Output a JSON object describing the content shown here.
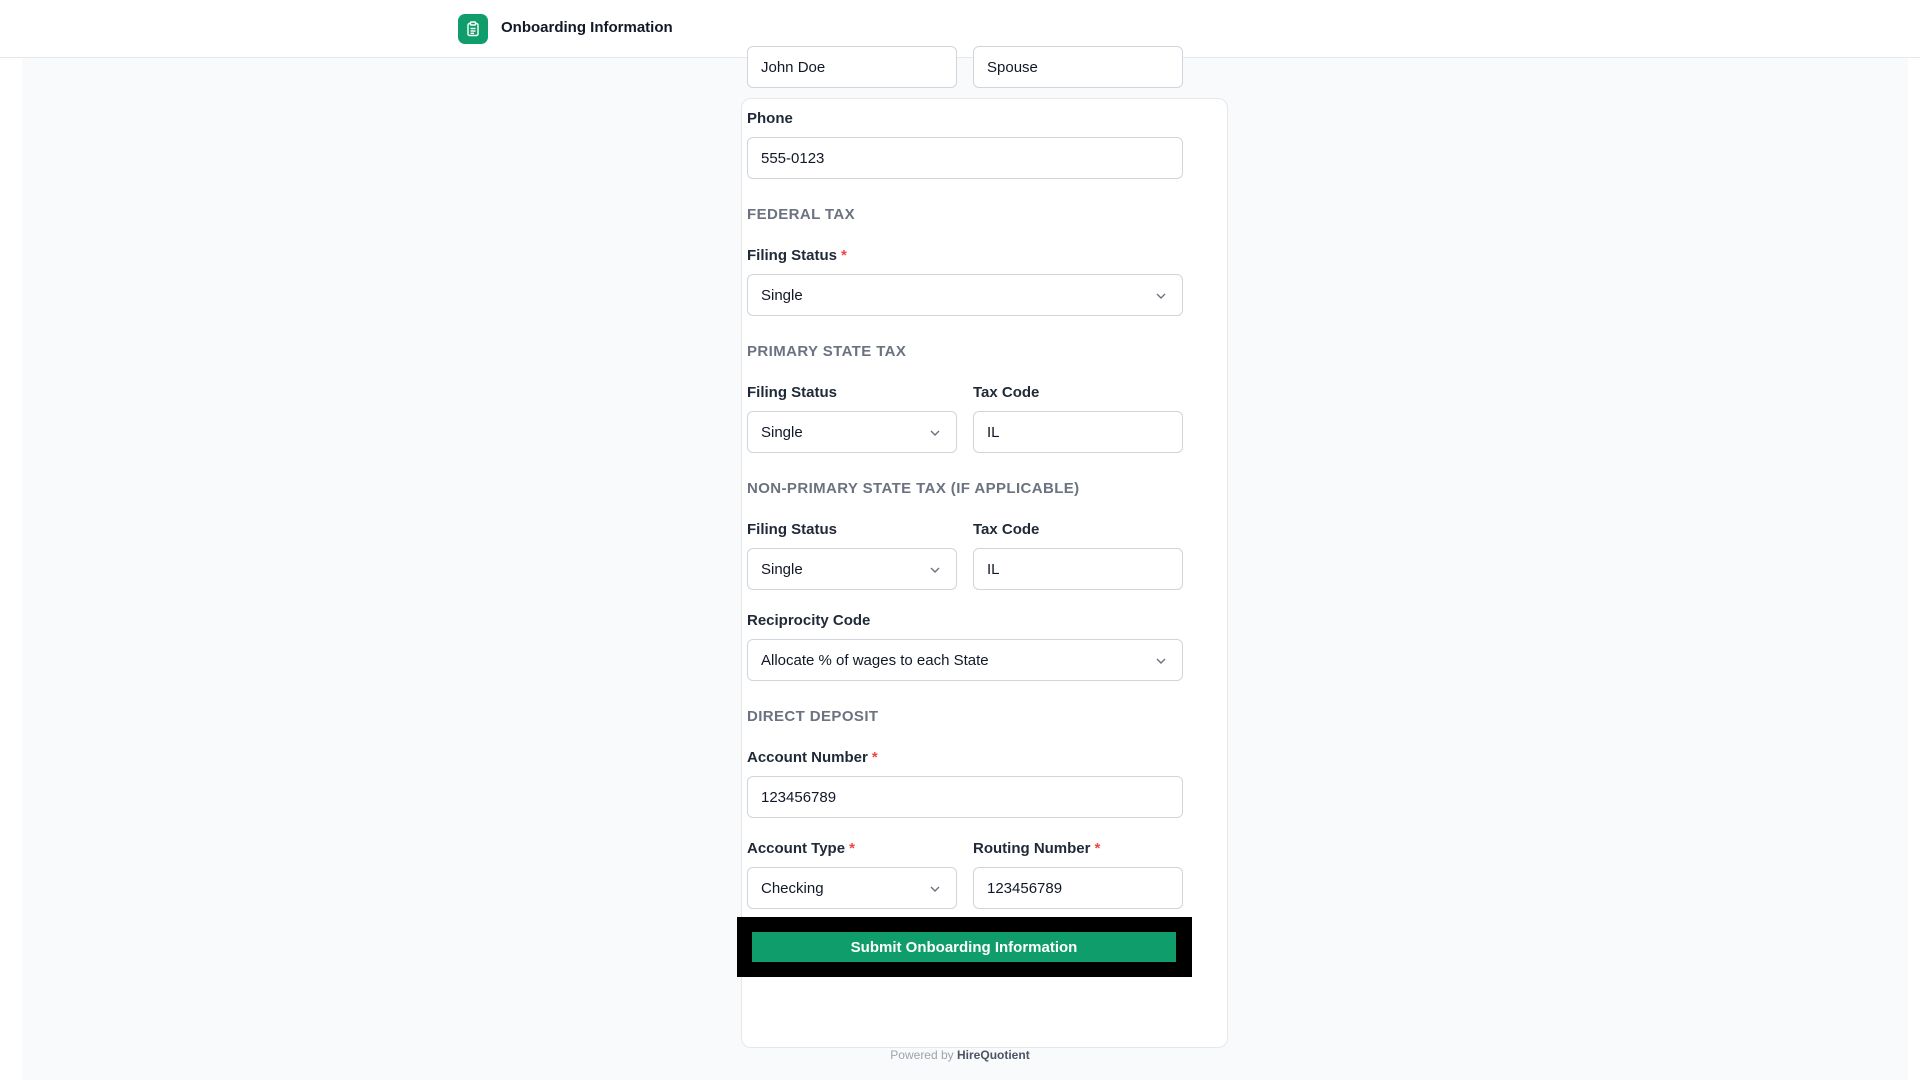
{
  "header": {
    "title": "Onboarding Information",
    "logo_icon": "clipboard-icon",
    "brand_color": "#0f9d6b"
  },
  "emergency": {
    "name_value": "John Doe",
    "relationship_value": "Spouse",
    "phone_label": "Phone",
    "phone_value": "555-0123"
  },
  "federal_tax": {
    "heading": "FEDERAL TAX",
    "filing_status_label": "Filing Status",
    "filing_status_value": "Single"
  },
  "primary_state_tax": {
    "heading": "PRIMARY STATE TAX",
    "filing_status_label": "Filing Status",
    "filing_status_value": "Single",
    "tax_code_label": "Tax Code",
    "tax_code_value": "IL"
  },
  "non_primary_state_tax": {
    "heading": "NON-PRIMARY STATE TAX (IF APPLICABLE)",
    "filing_status_label": "Filing Status",
    "filing_status_value": "Single",
    "tax_code_label": "Tax Code",
    "tax_code_value": "IL",
    "reciprocity_label": "Reciprocity Code",
    "reciprocity_value": "Allocate % of wages to each State"
  },
  "direct_deposit": {
    "heading": "DIRECT DEPOSIT",
    "account_number_label": "Account Number",
    "account_number_value": "123456789",
    "account_type_label": "Account Type",
    "account_type_value": "Checking",
    "routing_number_label": "Routing Number",
    "routing_number_value": "123456789"
  },
  "required_marker": "*",
  "submit_label": "Submit Onboarding Information",
  "footer": {
    "prefix": "Powered by",
    "brand": "HireQuotient"
  }
}
